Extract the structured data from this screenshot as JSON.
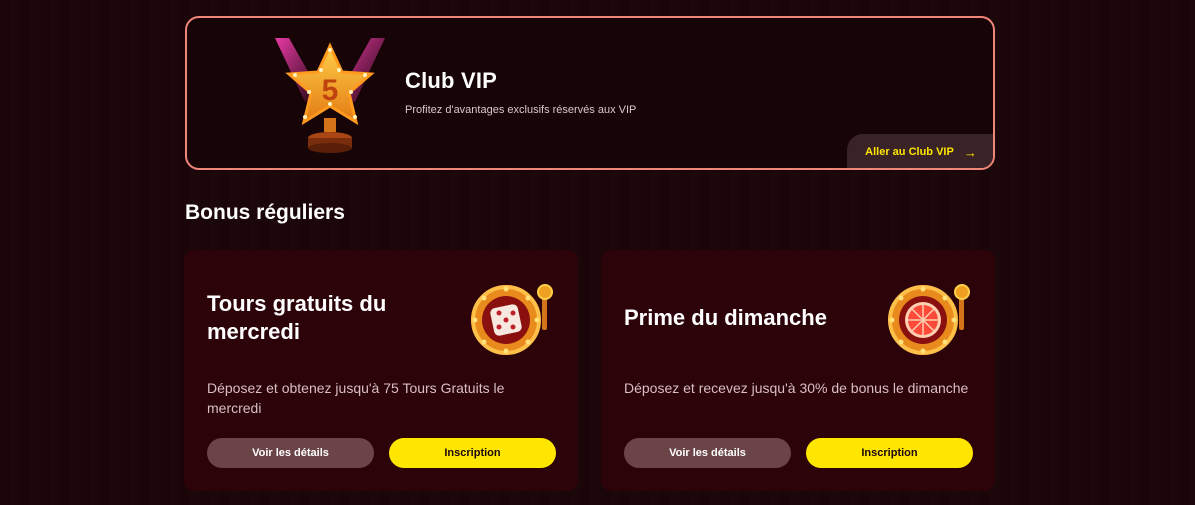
{
  "vip": {
    "title": "Club VIP",
    "subtitle": "Profitez d'avantages exclusifs réservés aux VIP",
    "cta_label": "Aller au Club VIP",
    "cta_icon": "arrow-right-icon",
    "badge_letter": "5"
  },
  "section": {
    "title": "Bonus réguliers"
  },
  "cards": [
    {
      "title": "Tours gratuits du mercredi",
      "description": "Déposez et obtenez jusqu'à 75 Tours Gratuits le mercredi",
      "details_label": "Voir les détails",
      "signup_label": "Inscription",
      "icon": "dice-slot-icon"
    },
    {
      "title": "Prime du dimanche",
      "description": "Déposez et recevez jusqu'à 30% de bonus le dimanche",
      "details_label": "Voir les détails",
      "signup_label": "Inscription",
      "icon": "grapefruit-slot-icon"
    }
  ],
  "colors": {
    "accent_yellow": "#ffe600",
    "banner_border": "#f0857a",
    "card_bg": "#2b0309",
    "page_bg": "#1a0609"
  }
}
